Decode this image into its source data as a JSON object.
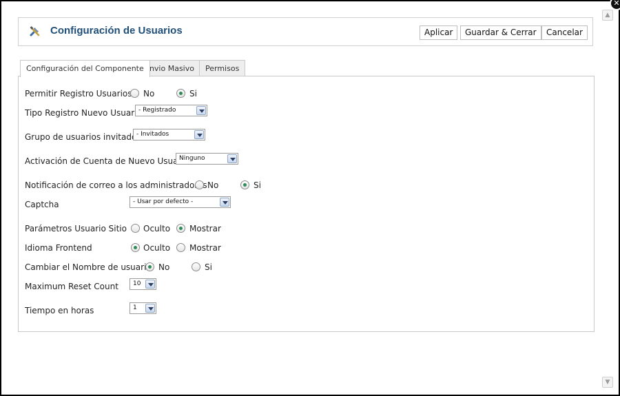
{
  "toolbar": {
    "title": "Configuración de Usuarios",
    "title_icon": "tools-icon",
    "buttons": {
      "apply": "Aplicar",
      "save_close": "Guardar & Cerrar",
      "cancel": "Cancelar"
    }
  },
  "tabs": [
    "Configuración del Componente",
    "Envio Masivo",
    "Permisos"
  ],
  "fields": {
    "allow_registration": {
      "label": "Permitir Registro Usuarios",
      "options": [
        "No",
        "Si"
      ],
      "selected": "Si"
    },
    "new_user_type": {
      "label": "Tipo Registro Nuevo Usuario",
      "value": "- Registrado"
    },
    "guest_group": {
      "label": "Grupo de usuarios invitados",
      "value": "- Invitados"
    },
    "activation": {
      "label": "Activación de Cuenta de Nuevo Usuario",
      "value": "Ninguno"
    },
    "admin_notification": {
      "label": "Notificación de correo a los administradores",
      "options": [
        "No",
        "Si"
      ],
      "selected": "Si"
    },
    "captcha": {
      "label": "Captcha",
      "value": "- Usar por defecto -"
    },
    "site_params": {
      "label": "Parámetros Usuario Sitio",
      "options": [
        "Oculto",
        "Mostrar"
      ],
      "selected": "Mostrar"
    },
    "frontend_language": {
      "label": "Idioma Frontend",
      "options": [
        "Oculto",
        "Mostrar"
      ],
      "selected": "Oculto"
    },
    "change_username": {
      "label": "Cambiar el Nombre de usuario",
      "options": [
        "No",
        "Si"
      ],
      "selected": "No"
    },
    "max_reset": {
      "label": "Maximum Reset Count",
      "value": "10"
    },
    "time_hours": {
      "label": "Tiempo en horas",
      "value": "1"
    }
  },
  "colors": {
    "title": "#1f4e79",
    "radio_dot": "#2e8b57",
    "backdrop": "#000000"
  }
}
